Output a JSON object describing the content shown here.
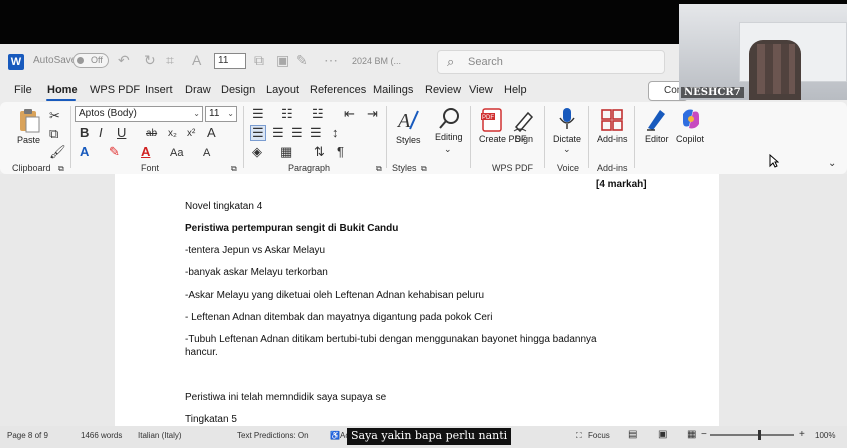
{
  "titlebar": {
    "autosave_label": "AutoSave",
    "autosave_state": "Off",
    "font_size_value": "11",
    "doc_title": "2024 BM (...",
    "search_placeholder": "Search"
  },
  "menu": {
    "items": [
      "File",
      "Home",
      "WPS PDF",
      "Insert",
      "Draw",
      "Design",
      "Layout",
      "References",
      "Mailings",
      "Review",
      "View",
      "Help"
    ],
    "active": "Home",
    "comments_label": "Com"
  },
  "ribbon": {
    "clipboard": {
      "paste_label": "Paste",
      "group_label": "Clipboard"
    },
    "font": {
      "font_name": "Aptos (Body)",
      "font_size": "11",
      "group_label": "Font",
      "buttons": [
        "B",
        "I",
        "U",
        "ab",
        "x₂",
        "x²",
        "A"
      ],
      "case_label": "Aa"
    },
    "paragraph": {
      "group_label": "Paragraph"
    },
    "styles": {
      "label": "Styles",
      "group_label": "Styles"
    },
    "editing": {
      "label": "Editing"
    },
    "wps_pdf": {
      "create_label": "Create PDF",
      "sign_label": "Sign",
      "group_label": "WPS PDF"
    },
    "voice": {
      "dictate_label": "Dictate",
      "group_label": "Voice"
    },
    "addins": {
      "label": "Add-ins",
      "group_label": "Add-ins"
    },
    "editor_label": "Editor",
    "copilot_label": "Copilot"
  },
  "document": {
    "markah": "[4 markah]",
    "lines": [
      "Novel tingkatan 4",
      "Peristiwa pertempuran sengit di Bukit Candu",
      "-tentera Jepun vs Askar Melayu",
      "-banyak askar Melayu terkorban",
      "-Askar Melayu yang diketuai oleh Leftenan Adnan kehabisan peluru",
      "- Leftenan Adnan ditembak dan mayatnya digantung pada pokok Ceri",
      "-Tubuh Leftenan Adnan ditikam bertubi-tubi dengan menggunakan bayonet hingga badannya",
      "hancur.",
      "Peristiwa ini telah memndidik saya supaya se",
      "Tingkatan 5"
    ]
  },
  "statusbar": {
    "page": "Page 8 of 9",
    "words": "1466 words",
    "language": "Italian (Italy)",
    "text_predictions": "Text Predictions: On",
    "accessibility": "Ac",
    "focus": "Focus",
    "zoom": "100%"
  },
  "overlay": {
    "subtitle": "Saya yakin bapa perlu nanti",
    "webcam_name": "NESHCR7"
  }
}
